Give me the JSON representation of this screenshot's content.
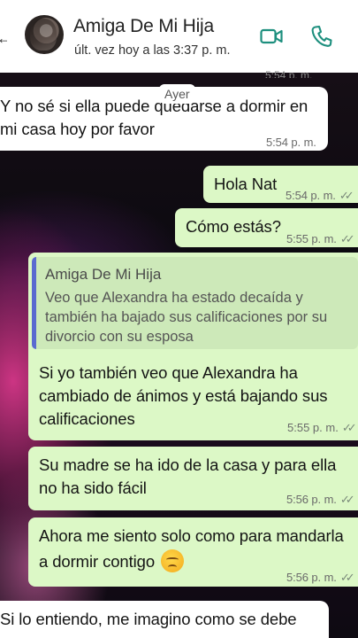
{
  "header": {
    "back_glyph": "←",
    "contact_name": "Amiga De Mi Hija",
    "last_seen": "últ. vez hoy a las 3:37 p. m.",
    "partial_time": "5:54 p. m.",
    "icons": [
      "back-arrow-icon",
      "video-call-icon",
      "phone-call-icon"
    ]
  },
  "date_chip": "Ayer",
  "messages": [
    {
      "direction": "in",
      "text": "Y no sé si ella puede quedarse a dormir en mi casa hoy por favor",
      "line1": "Y no sé si ella puede quedarse a dormir en",
      "line2": "mi casa hoy por favor",
      "time": "5:54 p. m."
    },
    {
      "direction": "out",
      "text": "Hola Nat",
      "time": "5:54 p. m."
    },
    {
      "direction": "out",
      "text": "Cómo estás?",
      "time": "5:55 p. m."
    },
    {
      "direction": "out",
      "quote": {
        "author": "Amiga De Mi Hija",
        "text": "Veo que Alexandra ha estado decaída y también ha bajado sus calificaciones por su divorcio con su esposa",
        "line1": "Veo que Alexandra ha estado decaída y",
        "line2": "también ha bajado sus calificaciones por su",
        "line3": "divorcio con su esposa"
      },
      "text": "Si yo también veo que Alexandra ha cambiado de ánimos y está bajando sus calificaciones",
      "line1": "Si yo también veo que Alexandra ha",
      "line2": "cambiado de ánimos y está bajando sus",
      "line3": "calificaciones",
      "time": "5:55 p. m."
    },
    {
      "direction": "out",
      "text": "Su madre se ha ido de la casa y para ella no ha sido fácil",
      "line1": "Su madre se ha ido de la casa y para ella",
      "line2": "no ha sido fácil",
      "time": "5:56 p. m."
    },
    {
      "direction": "out",
      "text": "Ahora me siento solo como para mandarla a dormir contigo",
      "line1": "Ahora me siento solo como para mandarla",
      "line2": "a dormir contigo",
      "emoji": "disappointed-face-icon",
      "time": "5:56 p. m."
    },
    {
      "direction": "in",
      "text": "Si lo entiendo, me imagino como se debe",
      "time": ""
    }
  ],
  "colors": {
    "incoming_bubble": "#ffffff",
    "outgoing_bubble": "#dcf8c6",
    "quote_bar": "#5a6ad0",
    "read_ticks": "#7a8a7a"
  }
}
